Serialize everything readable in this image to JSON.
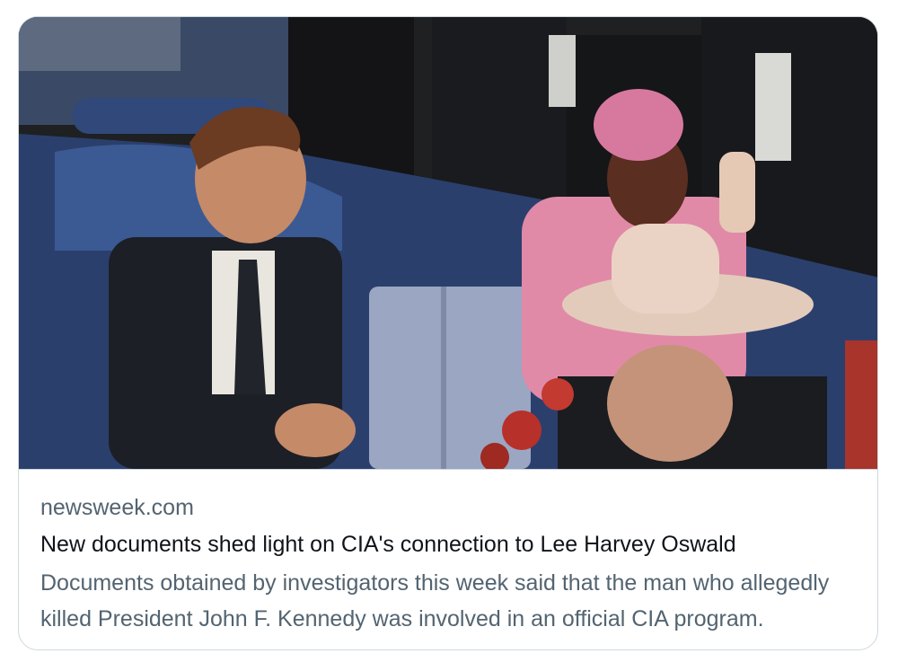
{
  "card": {
    "domain": "newsweek.com",
    "title": "New documents shed light on CIA's connection to Lee Harvey Oswald",
    "description": "Documents obtained by investigators this week said that the man who allegedly killed President John F. Kennedy was involved in an official CIA program."
  },
  "colors": {
    "border": "#cfd9de",
    "title": "#0f1419",
    "secondary": "#536471"
  }
}
